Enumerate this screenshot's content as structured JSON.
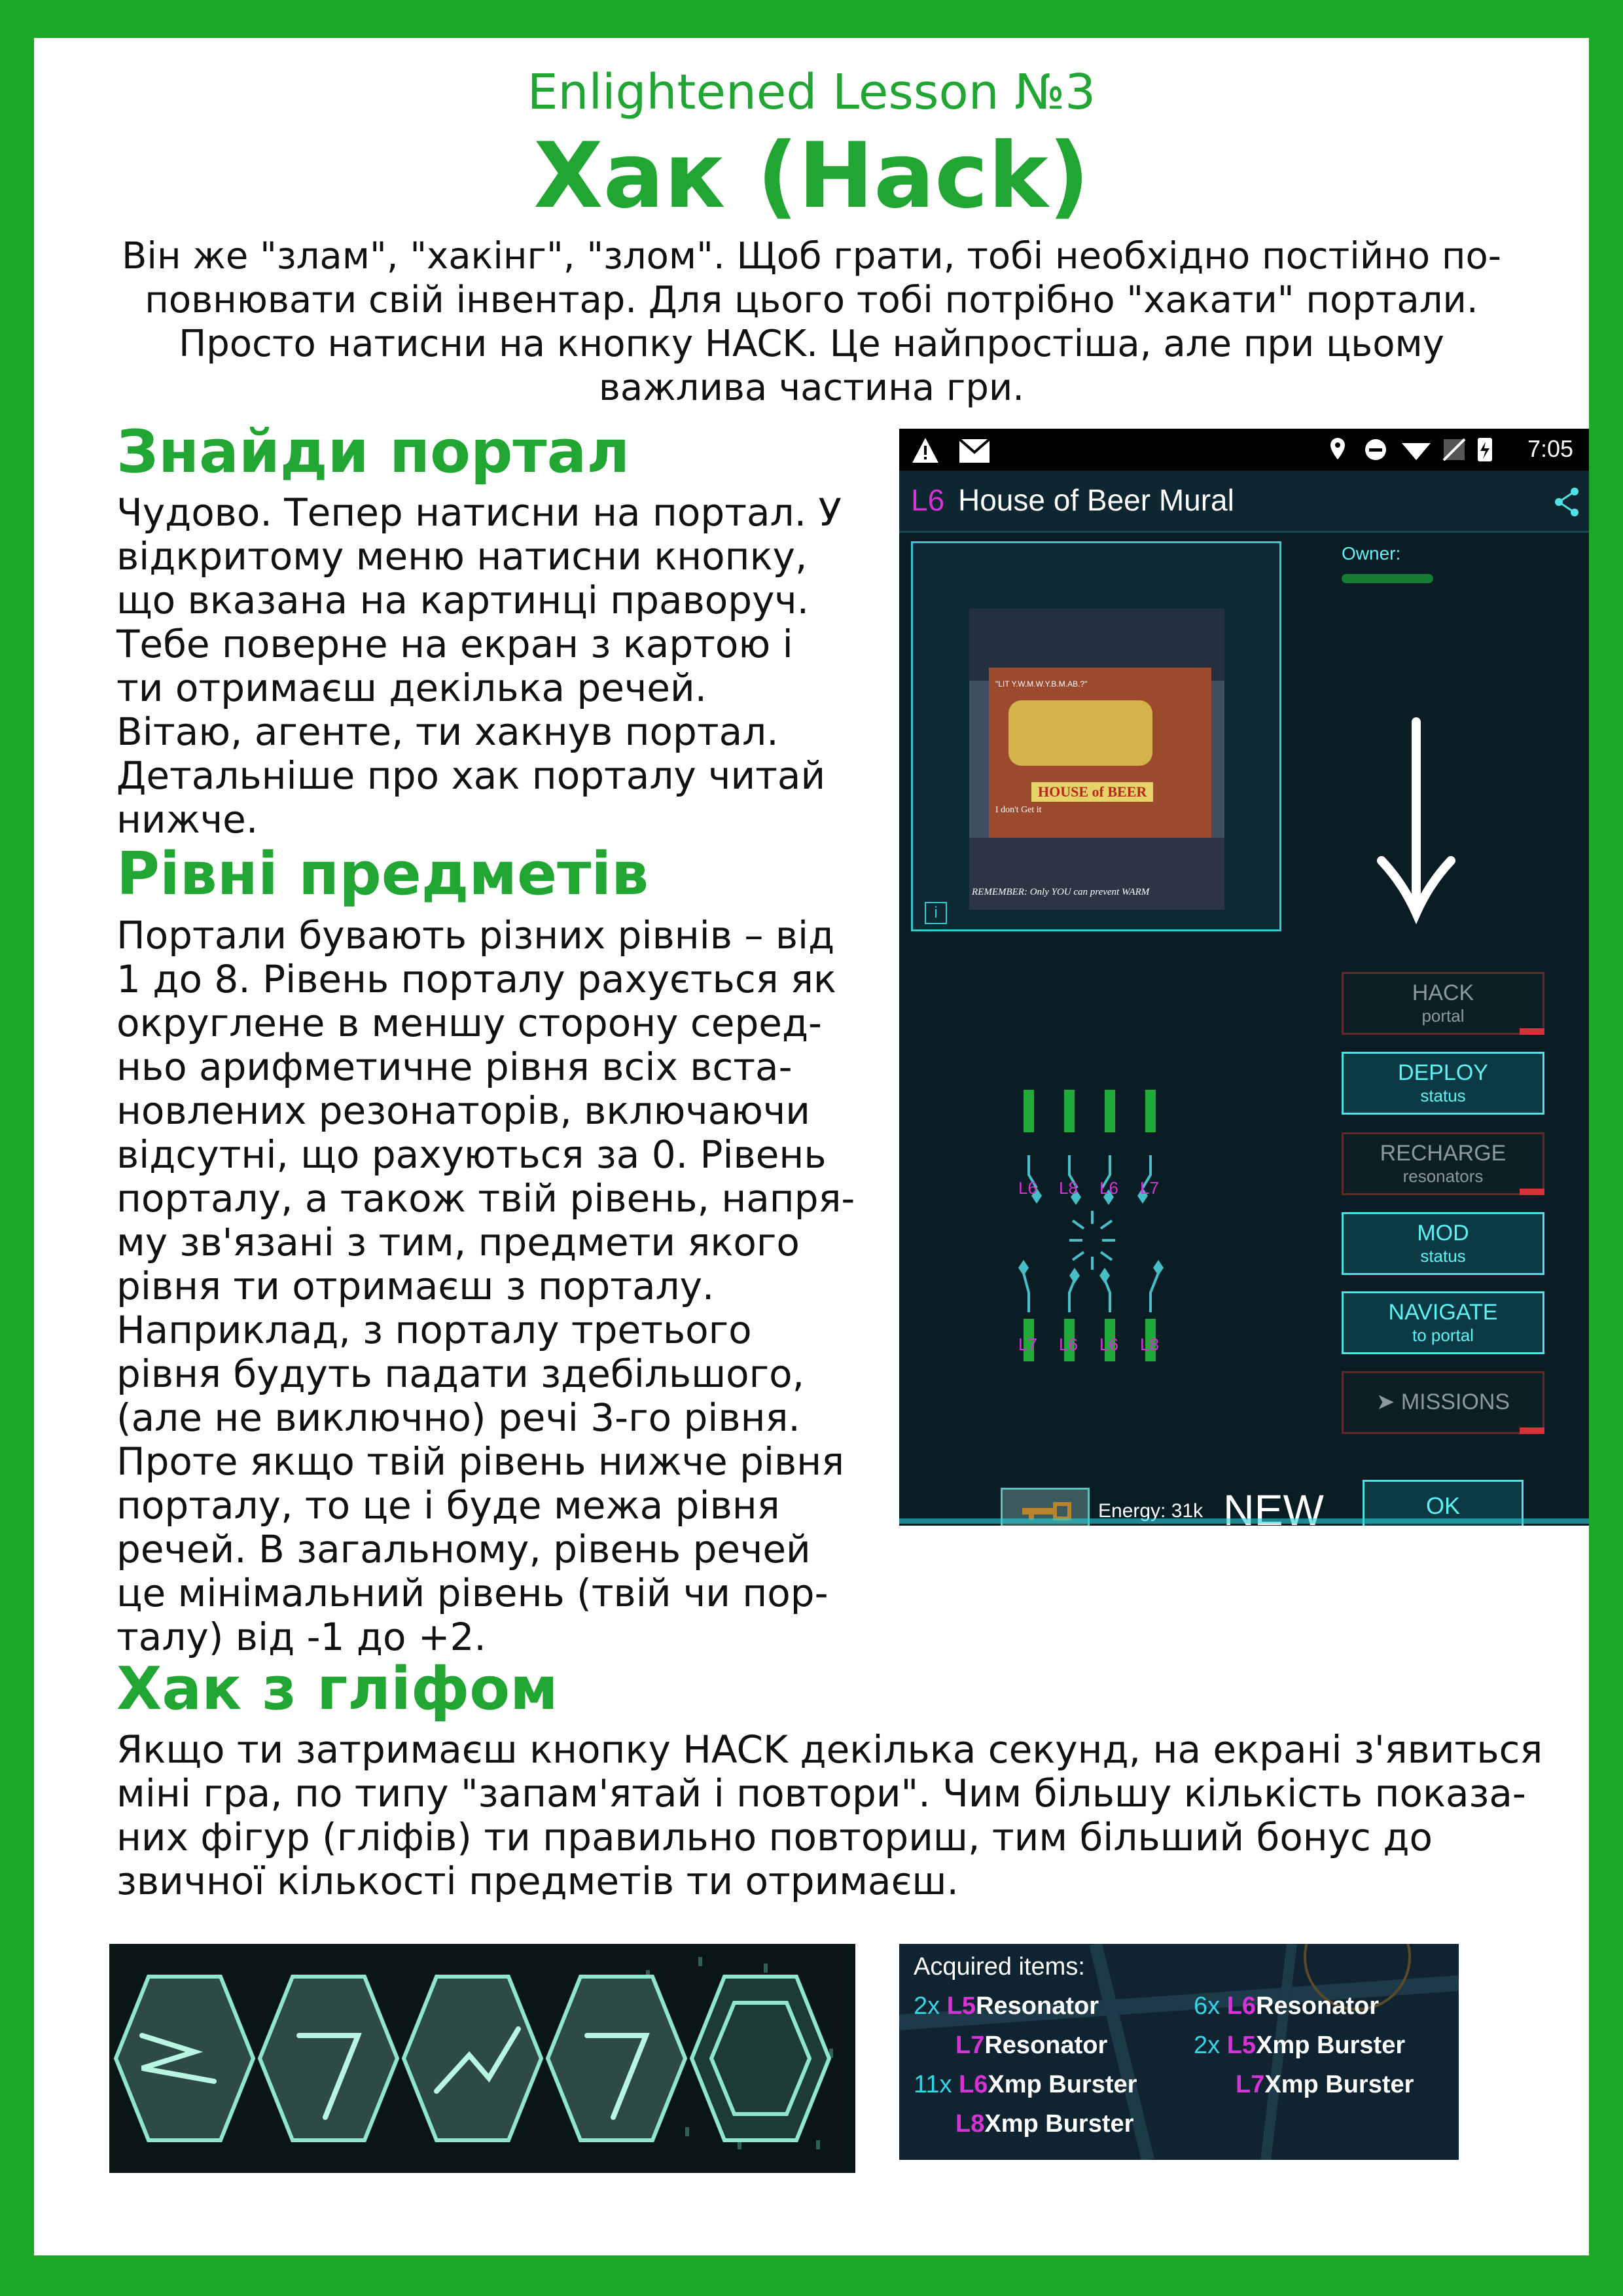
{
  "subtitle": "Enlightened Lesson №3",
  "title": "Хак (Hack)",
  "intro": [
    "Він же \"злам\", \"хакінг\", \"злом\". Щоб грати, тобі необхідно постійно по-",
    "повнювати свій інвентар. Для цього тобі потрібно \"хакати\" портали.",
    "Просто натисни на кнопку HACK. Це найпростіша, але при цьому",
    "важлива частина гри."
  ],
  "section1": {
    "heading": "Знайди портал",
    "lines": [
      "Чудово. Тепер натисни на портал. У",
      "відкритому меню натисни кнопку,",
      "що вказана на картинці праворуч.",
      "Тебе поверне на екран з картою і",
      "ти отримаєш декілька речей.",
      "Вітаю, агенте, ти хакнув портал.",
      "Детальніше про хак порталу читай",
      "нижче."
    ]
  },
  "section2": {
    "heading": "Рівні предметів",
    "lines": [
      "Портали бувають різних рівнів – від",
      "1 до 8. Рівень порталу рахується  як",
      "округлене в меншу сторону серед-",
      "ньо арифметичне рівня всіх вста-",
      "новлених резонаторів, включаючи",
      "відсутні, що рахуються за 0. Рівень",
      "порталу, а також твій рівень, напря-",
      "му зв'язані з тим, предмети якого",
      "рівня ти отримаєш з порталу.",
      "Наприклад, з порталу третього",
      "рівня будуть падати здебільшого,",
      "(але не виключно) речі 3-го рівня.",
      "Проте якщо твій рівень нижче рівня",
      "порталу, то це і буде межа рівня",
      "речей. В загальному, рівень речей",
      "це мінімальний рівень (твій чи пор-",
      "талу)  від -1 до +2."
    ]
  },
  "section3": {
    "heading": "Хак з гліфом",
    "lines": [
      "Якщо ти затримаєш кнопку HACK декілька секунд, на екрані з'явиться",
      "міні гра, по типу \"запам'ятай і повтори\". Чим більшу кількість показа-",
      "них фігур (гліфів) ти правильно повториш,  тим більший бонус до",
      "звичної кількості предметів ти отримаєш."
    ]
  },
  "phone": {
    "time": "7:05",
    "portal_level": "L6",
    "portal_name": "House of Beer Mural",
    "owner_label": "Owner:",
    "mural_text": [
      "\"LIT Y.W.M.W.Y.B.M.AB.?\"",
      "HOUSE of BEER",
      "I don't Get it",
      "REMEMBER: Only YOU can prevent WARM"
    ],
    "resonators_top": [
      "L6",
      "L8",
      "L6",
      "L7"
    ],
    "resonators_bottom": [
      "L7",
      "L6",
      "L6",
      "L8"
    ],
    "buttons": [
      {
        "l1": "HACK",
        "l2": "portal"
      },
      {
        "l1": "DEPLOY",
        "l2": "status"
      },
      {
        "l1": "RECHARGE",
        "l2": "resonators"
      },
      {
        "l1": "MOD",
        "l2": "status"
      },
      {
        "l1": "NAVIGATE",
        "l2": "to portal"
      },
      {
        "l1": "MISSIONS",
        "l2": ""
      }
    ],
    "energy": "Energy: 31k",
    "new_label": "NEW",
    "ok_label": "OK"
  },
  "acquired": {
    "title": "Acquired items:",
    "items": [
      {
        "count": "2x",
        "level": "L5",
        "name": "Resonator"
      },
      {
        "count": "6x",
        "level": "L6",
        "name": "Resonator"
      },
      {
        "count": "",
        "level": "L7",
        "name": "Resonator"
      },
      {
        "count": "2x",
        "level": "L5",
        "name": "Xmp Burster"
      },
      {
        "count": "11x",
        "level": "L6",
        "name": "Xmp Burster"
      },
      {
        "count": "",
        "level": "L7",
        "name": "Xmp Burster"
      },
      {
        "count": "",
        "level": "L8",
        "name": "Xmp Burster"
      }
    ]
  },
  "colors": {
    "frame": "#1ea82a",
    "accent": "#21a634",
    "phone_bg": "#0a1d25",
    "cyan": "#5ef2f4"
  }
}
